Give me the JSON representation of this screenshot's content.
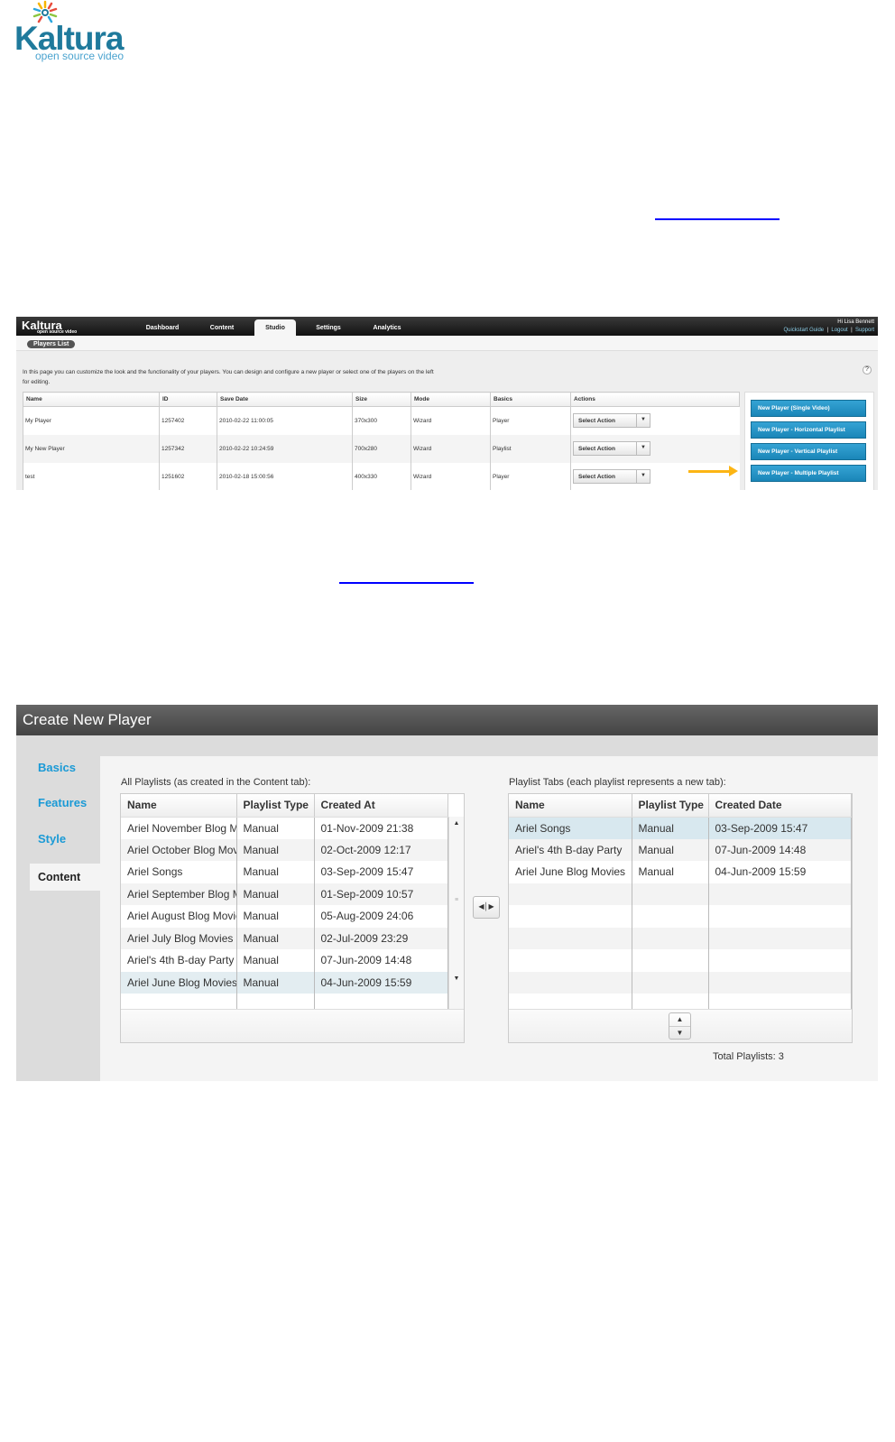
{
  "logo": {
    "word": "Kaltura",
    "tagline": "open source video"
  },
  "shot1": {
    "brand": "Kaltura",
    "brand_sub": "open source video",
    "tabs": [
      "Dashboard",
      "Content",
      "Studio",
      "Settings",
      "Analytics"
    ],
    "active_tab": "Studio",
    "user": {
      "greeting": "Hi Lisa Bennett",
      "links": [
        "Quickstart Guide",
        "Logout",
        "Support"
      ],
      "sep": "|"
    },
    "subnav": "Players List",
    "intro": "In this page you can customize the look and the functionality of your players. You can design and configure a new player or select one of the players on the left for editing.",
    "help": "?",
    "columns": [
      "Name",
      "ID",
      "Save Date",
      "Size",
      "Mode",
      "Basics",
      "Actions"
    ],
    "rows": [
      [
        "My Player",
        "1257402",
        "2010-02-22 11:00:05",
        "370x300",
        "Wizard",
        "Player"
      ],
      [
        "My New Player",
        "1257342",
        "2010-02-22 10:24:59",
        "700x280",
        "Wizard",
        "Playlist"
      ],
      [
        "test",
        "1251602",
        "2010-02-18 15:00:56",
        "400x330",
        "Wizard",
        "Player"
      ]
    ],
    "select_action": "Select Action",
    "buttons": [
      "New Player (Single Video)",
      "New Player - Horizontal Playlist",
      "New Player - Vertical Playlist",
      "New Player - Multiple Playlist"
    ],
    "arrow_color": "#fcb514"
  },
  "shot2": {
    "title": "Create New Player",
    "nav": [
      "Basics",
      "Features",
      "Style",
      "Content"
    ],
    "active_nav": "Content",
    "left_label": "All Playlists (as created in the Content tab):",
    "left_columns": [
      "Name",
      "Playlist Type",
      "Created At"
    ],
    "left_rows": [
      [
        "Ariel November Blog Movies",
        "Manual",
        "01-Nov-2009 21:38"
      ],
      [
        "Ariel October Blog Movies",
        "Manual",
        "02-Oct-2009 12:17"
      ],
      [
        "Ariel Songs",
        "Manual",
        "03-Sep-2009 15:47"
      ],
      [
        "Ariel September Blog Movies",
        "Manual",
        "01-Sep-2009 10:57"
      ],
      [
        "Ariel August Blog Movies",
        "Manual",
        "05-Aug-2009 24:06"
      ],
      [
        "Ariel July Blog Movies",
        "Manual",
        "02-Jul-2009 23:29"
      ],
      [
        "Ariel's 4th B-day Party",
        "Manual",
        "07-Jun-2009 14:48"
      ],
      [
        "Ariel June Blog Movies",
        "Manual",
        "04-Jun-2009 15:59"
      ]
    ],
    "right_label": "Playlist Tabs (each playlist represents a new tab):",
    "right_columns": [
      "Name",
      "Playlist Type",
      "Created Date"
    ],
    "right_rows": [
      [
        "Ariel Songs",
        "Manual",
        "03-Sep-2009 15:47"
      ],
      [
        "Ariel's 4th B-day Party",
        "Manual",
        "07-Jun-2009 14:48"
      ],
      [
        "Ariel June Blog Movies",
        "Manual",
        "04-Jun-2009 15:59"
      ]
    ],
    "total": "Total Playlists: 3",
    "accent": "#1a9ad6"
  }
}
